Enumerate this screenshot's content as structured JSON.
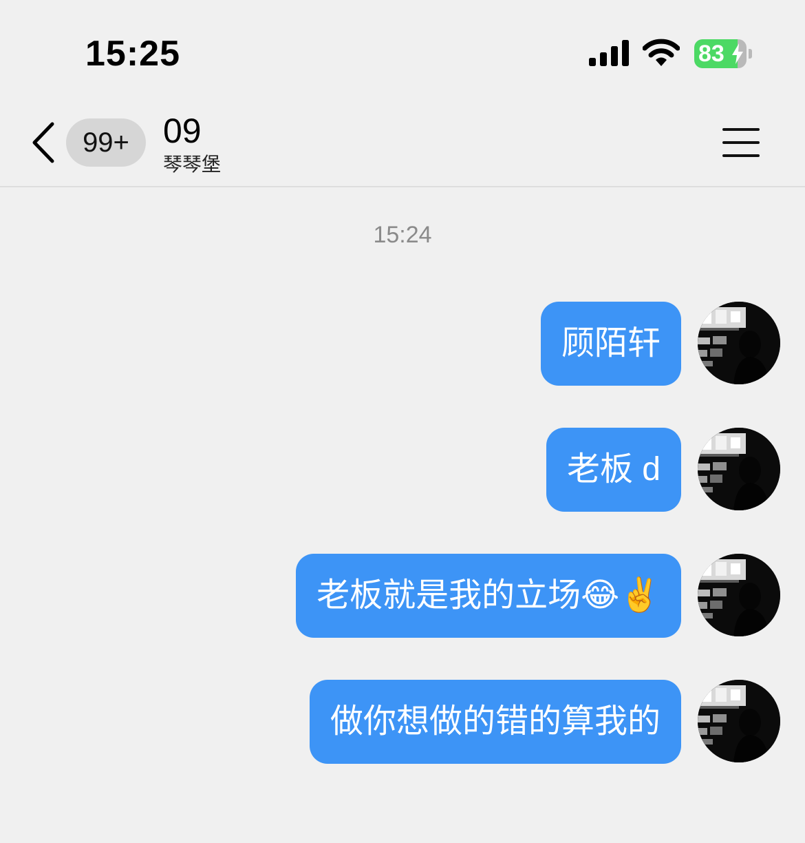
{
  "status_bar": {
    "time": "15:25",
    "battery_percent": "83",
    "battery_level": 0.83,
    "charging": true
  },
  "header": {
    "unread_count": "99+",
    "title": "09",
    "subtitle": "琴琴堡"
  },
  "conversation": {
    "timestamp": "15:24",
    "messages": [
      {
        "text": "顾陌轩",
        "sender": "self"
      },
      {
        "text": "老板 d",
        "sender": "self"
      },
      {
        "text": "老板就是我的立场😂✌️",
        "sender": "self"
      },
      {
        "text": "做你想做的错的算我的",
        "sender": "self"
      }
    ]
  },
  "colors": {
    "bubble": "#3d94f6",
    "background": "#f0f0f0",
    "battery": "#4cd964"
  }
}
